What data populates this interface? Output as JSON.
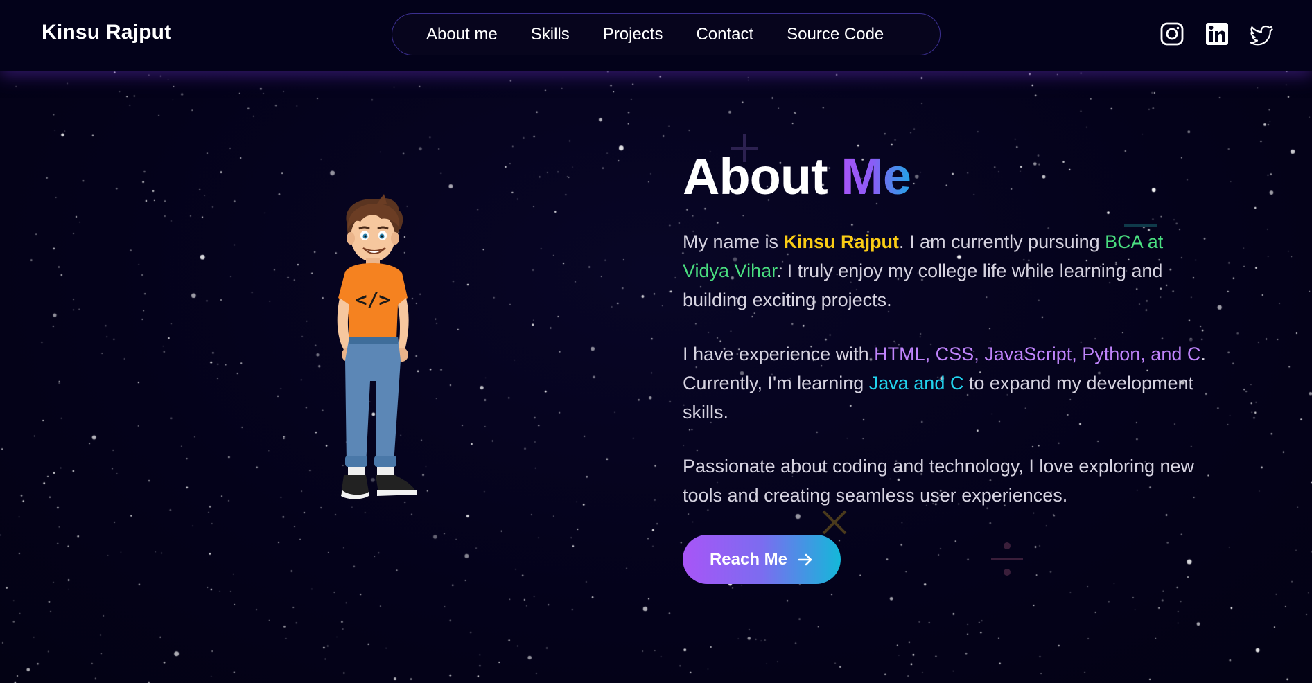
{
  "header": {
    "brand": "Kinsu Rajput",
    "nav": [
      {
        "label": "About me"
      },
      {
        "label": "Skills"
      },
      {
        "label": "Projects"
      },
      {
        "label": "Contact"
      },
      {
        "label": "Source Code"
      }
    ],
    "socials": [
      {
        "icon": "instagram-icon"
      },
      {
        "icon": "linkedin-icon"
      },
      {
        "icon": "twitter-icon"
      }
    ]
  },
  "about": {
    "title_part1": "About",
    "title_part2": "Me",
    "p1": {
      "t1": "My name is ",
      "name": "Kinsu Rajput",
      "t2": ". I am currently pursuing ",
      "college": "BCA at Vidya Vihar",
      "t3": ". I truly enjoy my college life while learning and building exciting projects."
    },
    "p2": {
      "t1": "I have experience with ",
      "skills": "HTML, CSS, JavaScript, Python, and C",
      "t2": ". Currently, I'm learning ",
      "learning": "Java and C",
      "t3": " to expand my development skills."
    },
    "p3": "Passionate about coding and technology, I love exploring new tools and creating seamless user experiences.",
    "cta_label": "Reach Me"
  },
  "illustration": {
    "shirt_text": "</>"
  },
  "colors": {
    "background": "#05031a",
    "accent_purple": "#a855f7",
    "accent_cyan": "#22d3ee",
    "highlight_yellow": "#facc15",
    "highlight_green": "#4ade80"
  }
}
